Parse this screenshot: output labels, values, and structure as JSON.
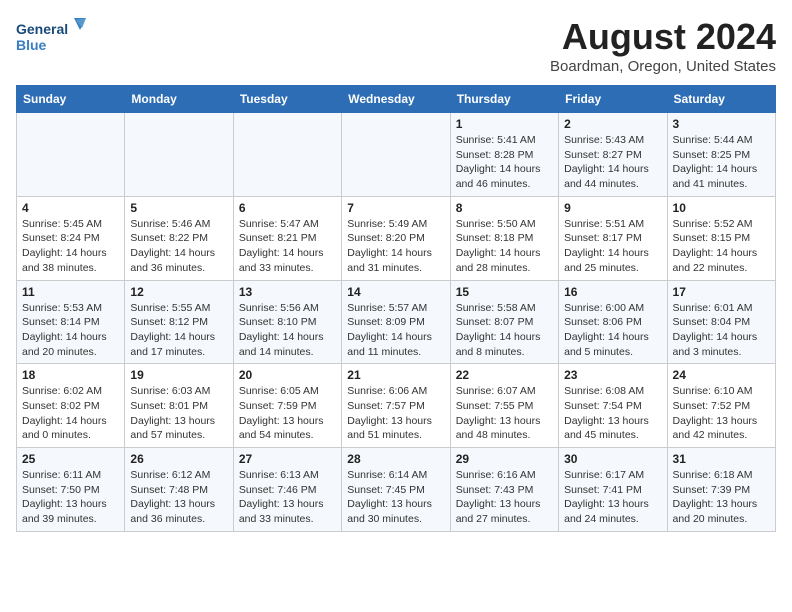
{
  "logo": {
    "line1": "General",
    "line2": "Blue"
  },
  "title": "August 2024",
  "subtitle": "Boardman, Oregon, United States",
  "days_of_week": [
    "Sunday",
    "Monday",
    "Tuesday",
    "Wednesday",
    "Thursday",
    "Friday",
    "Saturday"
  ],
  "weeks": [
    [
      {
        "day": "",
        "info": ""
      },
      {
        "day": "",
        "info": ""
      },
      {
        "day": "",
        "info": ""
      },
      {
        "day": "",
        "info": ""
      },
      {
        "day": "1",
        "info": "Sunrise: 5:41 AM\nSunset: 8:28 PM\nDaylight: 14 hours and 46 minutes."
      },
      {
        "day": "2",
        "info": "Sunrise: 5:43 AM\nSunset: 8:27 PM\nDaylight: 14 hours and 44 minutes."
      },
      {
        "day": "3",
        "info": "Sunrise: 5:44 AM\nSunset: 8:25 PM\nDaylight: 14 hours and 41 minutes."
      }
    ],
    [
      {
        "day": "4",
        "info": "Sunrise: 5:45 AM\nSunset: 8:24 PM\nDaylight: 14 hours and 38 minutes."
      },
      {
        "day": "5",
        "info": "Sunrise: 5:46 AM\nSunset: 8:22 PM\nDaylight: 14 hours and 36 minutes."
      },
      {
        "day": "6",
        "info": "Sunrise: 5:47 AM\nSunset: 8:21 PM\nDaylight: 14 hours and 33 minutes."
      },
      {
        "day": "7",
        "info": "Sunrise: 5:49 AM\nSunset: 8:20 PM\nDaylight: 14 hours and 31 minutes."
      },
      {
        "day": "8",
        "info": "Sunrise: 5:50 AM\nSunset: 8:18 PM\nDaylight: 14 hours and 28 minutes."
      },
      {
        "day": "9",
        "info": "Sunrise: 5:51 AM\nSunset: 8:17 PM\nDaylight: 14 hours and 25 minutes."
      },
      {
        "day": "10",
        "info": "Sunrise: 5:52 AM\nSunset: 8:15 PM\nDaylight: 14 hours and 22 minutes."
      }
    ],
    [
      {
        "day": "11",
        "info": "Sunrise: 5:53 AM\nSunset: 8:14 PM\nDaylight: 14 hours and 20 minutes."
      },
      {
        "day": "12",
        "info": "Sunrise: 5:55 AM\nSunset: 8:12 PM\nDaylight: 14 hours and 17 minutes."
      },
      {
        "day": "13",
        "info": "Sunrise: 5:56 AM\nSunset: 8:10 PM\nDaylight: 14 hours and 14 minutes."
      },
      {
        "day": "14",
        "info": "Sunrise: 5:57 AM\nSunset: 8:09 PM\nDaylight: 14 hours and 11 minutes."
      },
      {
        "day": "15",
        "info": "Sunrise: 5:58 AM\nSunset: 8:07 PM\nDaylight: 14 hours and 8 minutes."
      },
      {
        "day": "16",
        "info": "Sunrise: 6:00 AM\nSunset: 8:06 PM\nDaylight: 14 hours and 5 minutes."
      },
      {
        "day": "17",
        "info": "Sunrise: 6:01 AM\nSunset: 8:04 PM\nDaylight: 14 hours and 3 minutes."
      }
    ],
    [
      {
        "day": "18",
        "info": "Sunrise: 6:02 AM\nSunset: 8:02 PM\nDaylight: 14 hours and 0 minutes."
      },
      {
        "day": "19",
        "info": "Sunrise: 6:03 AM\nSunset: 8:01 PM\nDaylight: 13 hours and 57 minutes."
      },
      {
        "day": "20",
        "info": "Sunrise: 6:05 AM\nSunset: 7:59 PM\nDaylight: 13 hours and 54 minutes."
      },
      {
        "day": "21",
        "info": "Sunrise: 6:06 AM\nSunset: 7:57 PM\nDaylight: 13 hours and 51 minutes."
      },
      {
        "day": "22",
        "info": "Sunrise: 6:07 AM\nSunset: 7:55 PM\nDaylight: 13 hours and 48 minutes."
      },
      {
        "day": "23",
        "info": "Sunrise: 6:08 AM\nSunset: 7:54 PM\nDaylight: 13 hours and 45 minutes."
      },
      {
        "day": "24",
        "info": "Sunrise: 6:10 AM\nSunset: 7:52 PM\nDaylight: 13 hours and 42 minutes."
      }
    ],
    [
      {
        "day": "25",
        "info": "Sunrise: 6:11 AM\nSunset: 7:50 PM\nDaylight: 13 hours and 39 minutes."
      },
      {
        "day": "26",
        "info": "Sunrise: 6:12 AM\nSunset: 7:48 PM\nDaylight: 13 hours and 36 minutes."
      },
      {
        "day": "27",
        "info": "Sunrise: 6:13 AM\nSunset: 7:46 PM\nDaylight: 13 hours and 33 minutes."
      },
      {
        "day": "28",
        "info": "Sunrise: 6:14 AM\nSunset: 7:45 PM\nDaylight: 13 hours and 30 minutes."
      },
      {
        "day": "29",
        "info": "Sunrise: 6:16 AM\nSunset: 7:43 PM\nDaylight: 13 hours and 27 minutes."
      },
      {
        "day": "30",
        "info": "Sunrise: 6:17 AM\nSunset: 7:41 PM\nDaylight: 13 hours and 24 minutes."
      },
      {
        "day": "31",
        "info": "Sunrise: 6:18 AM\nSunset: 7:39 PM\nDaylight: 13 hours and 20 minutes."
      }
    ]
  ]
}
